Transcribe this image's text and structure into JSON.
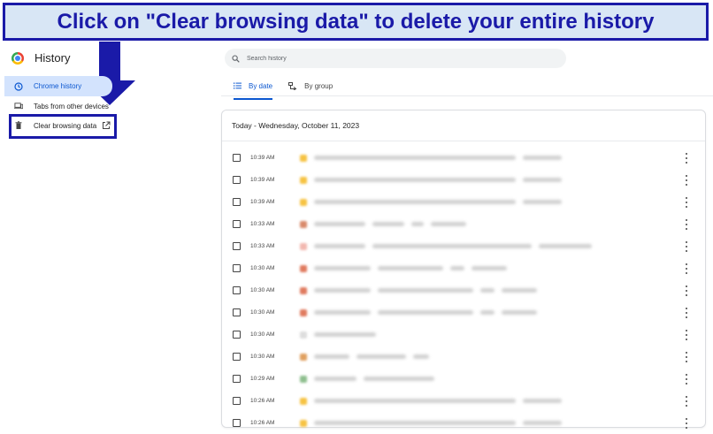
{
  "annotation": {
    "text": "Click on \"Clear browsing data\" to delete your entire history"
  },
  "sidebar": {
    "title": "History",
    "items": [
      {
        "label": "Chrome history",
        "icon": "clock-icon",
        "active": true
      },
      {
        "label": "Tabs from other devices",
        "icon": "devices-icon",
        "active": false
      },
      {
        "label": "Clear browsing data",
        "icon": "trash-icon",
        "active": false
      }
    ]
  },
  "search": {
    "placeholder": "Search history"
  },
  "tabs": [
    {
      "label": "By date",
      "icon": "list-icon",
      "active": true
    },
    {
      "label": "By group",
      "icon": "group-icon",
      "active": false
    }
  ],
  "history": {
    "date_header": "Today - Wednesday, October 11, 2023",
    "entries": [
      {
        "time": "10:39 AM",
        "favicon_color": "#f6c343"
      },
      {
        "time": "10:39 AM",
        "favicon_color": "#f6c343"
      },
      {
        "time": "10:39 AM",
        "favicon_color": "#f6c343"
      },
      {
        "time": "10:33 AM",
        "favicon_color": "#d98a6b"
      },
      {
        "time": "10:33 AM",
        "favicon_color": "#f2b8b0"
      },
      {
        "time": "10:30 AM",
        "favicon_color": "#e07b5f"
      },
      {
        "time": "10:30 AM",
        "favicon_color": "#e07b5f"
      },
      {
        "time": "10:30 AM",
        "favicon_color": "#e07b5f"
      },
      {
        "time": "10:30 AM",
        "favicon_color": "#dddddd"
      },
      {
        "time": "10:30 AM",
        "favicon_color": "#e0a060"
      },
      {
        "time": "10:29 AM",
        "favicon_color": "#8fbf8f"
      },
      {
        "time": "10:26 AM",
        "favicon_color": "#f6c343"
      },
      {
        "time": "10:26 AM",
        "favicon_color": "#f6c343"
      }
    ]
  },
  "colors": {
    "annotation_blue": "#1a1aa8",
    "banner_bg": "#d8e6f5",
    "accent": "#0b57d0",
    "active_nav_bg": "#d3e3fd"
  }
}
